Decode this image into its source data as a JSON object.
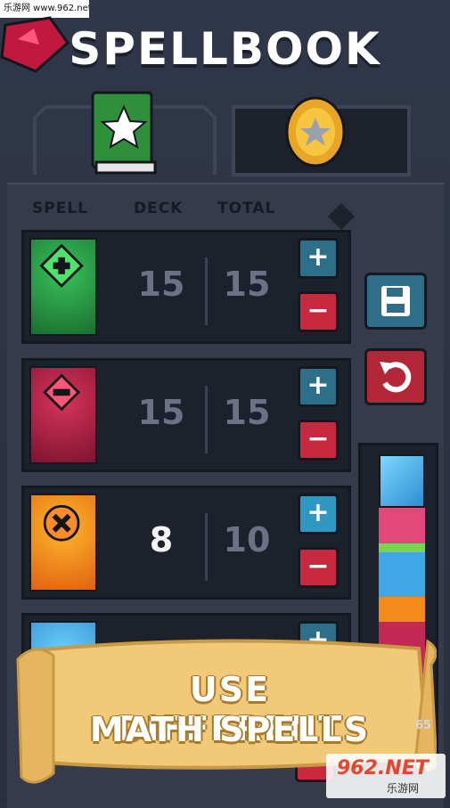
{
  "watermark_top": "乐游网 www.962.net",
  "title": "SPELLBOOK",
  "headers": {
    "spell": "SPELL",
    "deck": "DECK",
    "total": "TOTAL"
  },
  "spells": [
    {
      "symbol": "plus",
      "deck": "15",
      "total": "15",
      "color": "#1f8a3e",
      "deck_active": false,
      "plus_active": false
    },
    {
      "symbol": "minus",
      "deck": "15",
      "total": "15",
      "color": "#a81c3f",
      "deck_active": false,
      "plus_active": false
    },
    {
      "symbol": "multiply",
      "deck": "8",
      "total": "10",
      "color": "#f08a15",
      "deck_active": true,
      "plus_active": true
    }
  ],
  "buttons": {
    "plus": "+",
    "minus": "−"
  },
  "banner": {
    "line1": "USE DIFFERENT",
    "line2": "MATH SPELLS"
  },
  "stack_count": "65",
  "watermark_bottom": {
    "brand": "962.NET",
    "sub": "乐游网"
  },
  "colors": {
    "background": "#2b3140",
    "panel": "#1d212c",
    "plus_button": "#2f97c2",
    "minus_button": "#c8293f",
    "banner": "#f2c879"
  },
  "icons": [
    "green-spellbook-icon",
    "gold-star-coin-icon",
    "save-disk-icon",
    "undo-arrow-icon",
    "red-gem-icon"
  ]
}
